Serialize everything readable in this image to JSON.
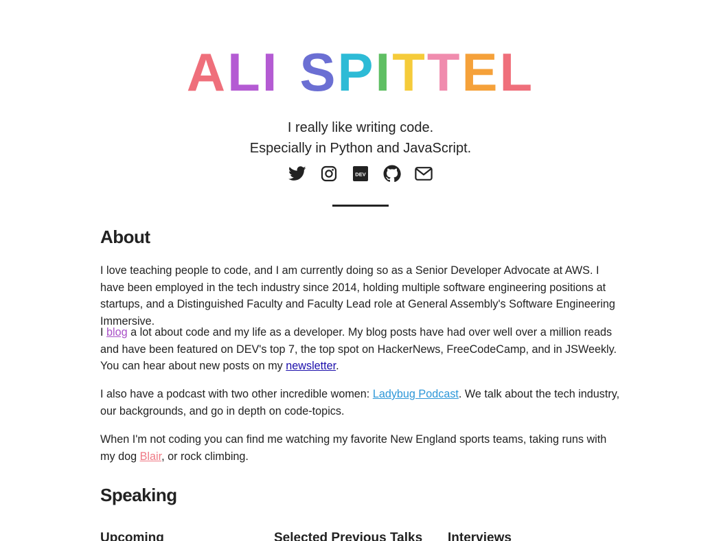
{
  "header": {
    "name_letters": [
      {
        "ch": "A",
        "color": "#ef6f7b"
      },
      {
        "ch": "L",
        "color": "#b45bd3"
      },
      {
        "ch": "I",
        "color": "#b45bd3"
      },
      {
        "ch": " ",
        "color": "#ffffff"
      },
      {
        "ch": "S",
        "color": "#6b6fd3"
      },
      {
        "ch": "P",
        "color": "#2dbbd6"
      },
      {
        "ch": "I",
        "color": "#5fbf63"
      },
      {
        "ch": "T",
        "color": "#f5cb3a"
      },
      {
        "ch": "T",
        "color": "#f08cae"
      },
      {
        "ch": "E",
        "color": "#f5a13a"
      },
      {
        "ch": "L",
        "color": "#ef6f7b"
      }
    ],
    "tagline_1": "I really like writing code.",
    "tagline_2": "Especially in Python and JavaScript."
  },
  "socials": [
    {
      "name": "twitter-icon"
    },
    {
      "name": "instagram-icon"
    },
    {
      "name": "dev-icon"
    },
    {
      "name": "github-icon"
    },
    {
      "name": "email-icon"
    }
  ],
  "about": {
    "heading": "About",
    "p1": "I love teaching people to code, and I am currently doing so as a Senior Developer Advocate at AWS. I have been employed in the tech industry since 2014, holding multiple software engineering positions at startups, and a Distinguished Faculty and Faculty Lead role at General Assembly's Software Engineering Immersive.",
    "p2_pre": "I ",
    "p2_link": "blog",
    "p2_mid": " a lot about code and my life as a developer. My blog posts have had over well over a million reads and have been featured on DEV's top 7, the top spot on HackerNews, FreeCodeCamp, and in JSWeekly. You can hear about new posts on my ",
    "p2_link2": "newsletter",
    "p2_post": ".",
    "p3_pre": "I also have a podcast with two other incredible women: ",
    "p3_link": "Ladybug Podcast",
    "p3_post": ". We talk about the tech industry, our backgrounds, and go in depth on code-topics.",
    "p4_pre": "When I'm not coding you can find me watching my favorite New England sports teams, taking runs with my dog ",
    "p4_link": "Blair",
    "p4_post": ", or rock climbing."
  },
  "speaking": {
    "heading": "Speaking",
    "col1": "Upcoming",
    "col2": "Selected Previous Talks",
    "col3": "Interviews"
  },
  "colors": {
    "blog_link": "#a84fc7",
    "newsletter_link": "#1a0dab",
    "podcast_link": "#2d97d8",
    "blair_link": "#ef7985"
  }
}
